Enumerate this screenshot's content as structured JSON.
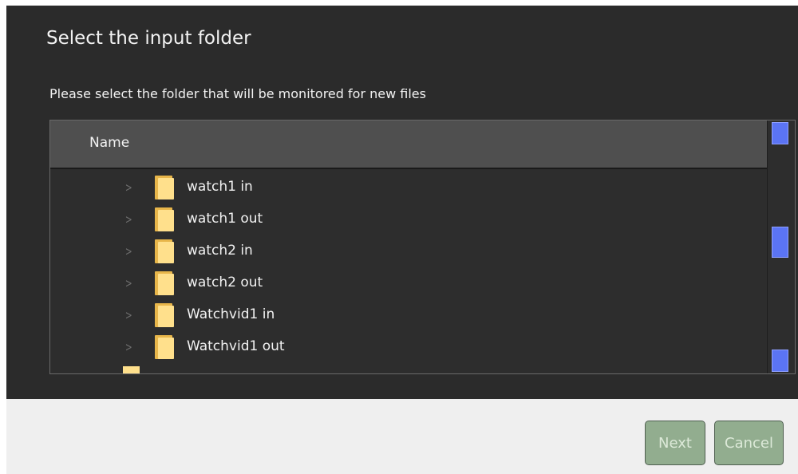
{
  "dialog": {
    "title": "Select the input folder",
    "subtitle": "Please select the folder that will be monitored for new files"
  },
  "tree": {
    "column_header": "Name",
    "rows": [
      {
        "label": "watch1 in",
        "icon": "folder-icon"
      },
      {
        "label": "watch1 out",
        "icon": "folder-icon"
      },
      {
        "label": "watch2 in",
        "icon": "folder-icon"
      },
      {
        "label": "watch2 out",
        "icon": "folder-icon"
      },
      {
        "label": "Watchvid1 in",
        "icon": "folder-icon"
      },
      {
        "label": "Watchvid1 out",
        "icon": "folder-icon"
      }
    ]
  },
  "buttons": {
    "next": "Next",
    "cancel": "Cancel"
  },
  "colors": {
    "panel_background": "#2b2b2b",
    "header_background": "#4f4f4f",
    "scrollbar_accent": "#5b74f4",
    "button_background": "#92ad8f",
    "folder_yellow": "#ffe08c"
  }
}
